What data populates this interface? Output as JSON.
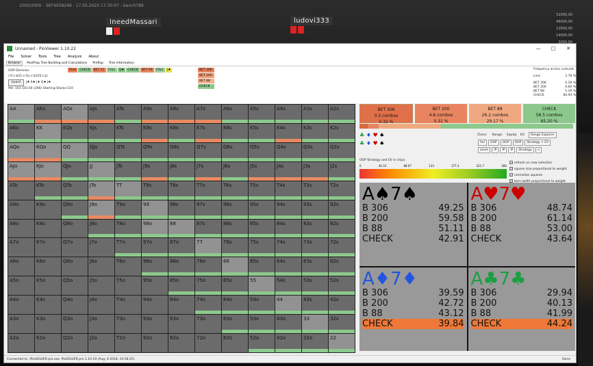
{
  "stream": {
    "topinfo": "1000/2000 - 3874058248 - 17.05.2020 17:30:07 - bench789",
    "player1": "IneedMassari",
    "player2": "ludovi333",
    "stacks": [
      "52000,00",
      "46000,00",
      "12000,00",
      "14000,00",
      "3000,00"
    ]
  },
  "window": {
    "title": "Unnamed - PioViewer 1.10.22",
    "min": "—",
    "max": "□",
    "close": "✕"
  },
  "menu": [
    "File",
    "Solver",
    "Tools",
    "Tree",
    "Analysis",
    "About"
  ],
  "tabs": [
    "Browser",
    "PostFlop Tree Building and Calculations",
    "Preflop",
    "Tree information"
  ],
  "decision": {
    "title": "OOP Decision",
    "board": "r:0:c:b21:c:Gc:c:b101:c:Jc",
    "board_btn": "board",
    "cards": "J♠  6♠  J♦  Q♠  J♠",
    "pot": "Pot: 101 101 64 (266) Starting Stacks:110"
  },
  "line": [
    "Root",
    "CHECK",
    "BET 21",
    "CALL",
    "Q♠",
    "CHECK",
    "BET 69",
    "CALL",
    "J♠"
  ],
  "bet_options": [
    "BET 306",
    "BET 200",
    "BET 88",
    "CHECK"
  ],
  "freq": {
    "title": "Frequency across cumulat.",
    "rows": [
      [
        "Line:",
        "2.78 %"
      ],
      [
        "BET 306",
        "0.18 %"
      ],
      [
        "BET 200",
        "0.60 %"
      ],
      [
        "BET 88",
        "5.19 %"
      ],
      [
        "CHECK",
        "84.93 %"
      ]
    ]
  },
  "grid": [
    [
      "AA",
      "AKs",
      "AQs",
      "AJs",
      "ATs",
      "A9s",
      "A8s",
      "A7s",
      "A6s",
      "A5s",
      "A4s",
      "A3s",
      "A2s"
    ],
    [
      "AKo",
      "KK",
      "KQs",
      "KJs",
      "KTs",
      "K9s",
      "K8s",
      "K7s",
      "K6s",
      "K5s",
      "K4s",
      "K3s",
      "K2s"
    ],
    [
      "AQo",
      "KQo",
      "QQ",
      "QJs",
      "QTs",
      "Q9s",
      "Q8s",
      "Q7s",
      "Q6s",
      "Q5s",
      "Q4s",
      "Q3s",
      "Q2s"
    ],
    [
      "AJo",
      "KJo",
      "QJo",
      "JJ",
      "JTs",
      "J9s",
      "J8s",
      "J7s",
      "J6s",
      "J5s",
      "J4s",
      "J3s",
      "J2s"
    ],
    [
      "ATo",
      "KTo",
      "QTo",
      "JTo",
      "TT",
      "T9s",
      "T8s",
      "T7s",
      "T6s",
      "T5s",
      "T4s",
      "T3s",
      "T2s"
    ],
    [
      "A9o",
      "K9o",
      "Q9o",
      "J9o",
      "T9o",
      "99",
      "98s",
      "97s",
      "96s",
      "95s",
      "94s",
      "93s",
      "92s"
    ],
    [
      "A8o",
      "K8o",
      "Q8o",
      "J8o",
      "T8o",
      "98o",
      "88",
      "87s",
      "86s",
      "85s",
      "84s",
      "83s",
      "82s"
    ],
    [
      "A7o",
      "K7o",
      "Q7o",
      "J7o",
      "T7o",
      "97o",
      "87o",
      "77",
      "76s",
      "75s",
      "74s",
      "73s",
      "72s"
    ],
    [
      "A6o",
      "K6o",
      "Q6o",
      "J6o",
      "T6o",
      "96o",
      "86o",
      "76o",
      "66",
      "65s",
      "64s",
      "63s",
      "62s"
    ],
    [
      "A5o",
      "K5o",
      "Q5o",
      "J5o",
      "T5o",
      "95o",
      "85o",
      "75o",
      "65o",
      "55",
      "54s",
      "53s",
      "52s"
    ],
    [
      "A4o",
      "K4o",
      "Q4o",
      "J4o",
      "T4o",
      "94o",
      "84o",
      "74o",
      "64o",
      "54o",
      "44",
      "43s",
      "42s"
    ],
    [
      "A3o",
      "K3o",
      "Q3o",
      "J3o",
      "T3o",
      "93o",
      "83o",
      "73o",
      "63o",
      "53o",
      "43o",
      "33",
      "32s"
    ],
    [
      "A2o",
      "K2o",
      "Q2o",
      "J2o",
      "T2o",
      "92o",
      "82o",
      "72o",
      "62o",
      "52o",
      "42o",
      "32o",
      "22"
    ]
  ],
  "summary": [
    {
      "label": "BET 306",
      "combos": "0.3 combos",
      "pct": "0.32 %"
    },
    {
      "label": "BET 200",
      "combos": "4.8 combos",
      "pct": "5.31 %"
    },
    {
      "label": "BET 88",
      "combos": "26.2 combos",
      "pct": "29.17 %"
    },
    {
      "label": "CHECK",
      "combos": "58.5 combos",
      "pct": "65.20 %"
    }
  ],
  "controls": {
    "clone": "Clone:",
    "range": "Range:",
    "equity": "Equity:",
    "ev": "EV:",
    "full": "full",
    "oop": "OOP",
    "ip": "IP",
    "zoom": "zoom",
    "range_explorer": "Range Explorer",
    "strategy_ev": "Strategy + EV",
    "strategy": "Strategy",
    "lt": "<"
  },
  "ev": {
    "title": "OOP Strategy and EV in chips",
    "scale": [
      "0",
      "44.33",
      "88.67",
      "133",
      "177.3",
      "221.7",
      "266"
    ]
  },
  "options": [
    "refresh on new selection",
    "square size proportional to weight",
    "normalize squares",
    "bars width proportional to weight"
  ],
  "combos": [
    {
      "rank1": "A",
      "s1": "♠",
      "rank2": "7",
      "s2": "♠",
      "color": "blk",
      "rows": [
        [
          "B 306",
          "49.25"
        ],
        [
          "B 200",
          "59.58"
        ],
        [
          "B 88",
          "51.11"
        ],
        [
          "CHECK",
          "42.91"
        ]
      ]
    },
    {
      "rank1": "A",
      "s1": "♥",
      "rank2": "7",
      "s2": "♥",
      "color": "red",
      "rows": [
        [
          "B 306",
          "48.74"
        ],
        [
          "B 200",
          "61.14"
        ],
        [
          "B 88",
          "53.00"
        ],
        [
          "CHECK",
          "43.64"
        ]
      ]
    },
    {
      "rank1": "A",
      "s1": "♦",
      "rank2": "7",
      "s2": "♦",
      "color": "blu",
      "rows": [
        [
          "B 306",
          "39.59"
        ],
        [
          "B 200",
          "42.72"
        ],
        [
          "B 88",
          "43.12"
        ],
        [
          "CHECK",
          "39.84"
        ]
      ]
    },
    {
      "rank1": "A",
      "s1": "♣",
      "rank2": "7",
      "s2": "♣",
      "color": "grn",
      "rows": [
        [
          "B 306",
          "29.94"
        ],
        [
          "B 200",
          "40.13"
        ],
        [
          "B 88",
          "41.99"
        ],
        [
          "CHECK",
          "44.24"
        ]
      ]
    }
  ],
  "status": "Connected to .\\PioSOLVER-pro.exe, PioSOLVER-pro 1.10.19 (Aug. 8 2018, 10:58:25)",
  "status_right": "Done"
}
